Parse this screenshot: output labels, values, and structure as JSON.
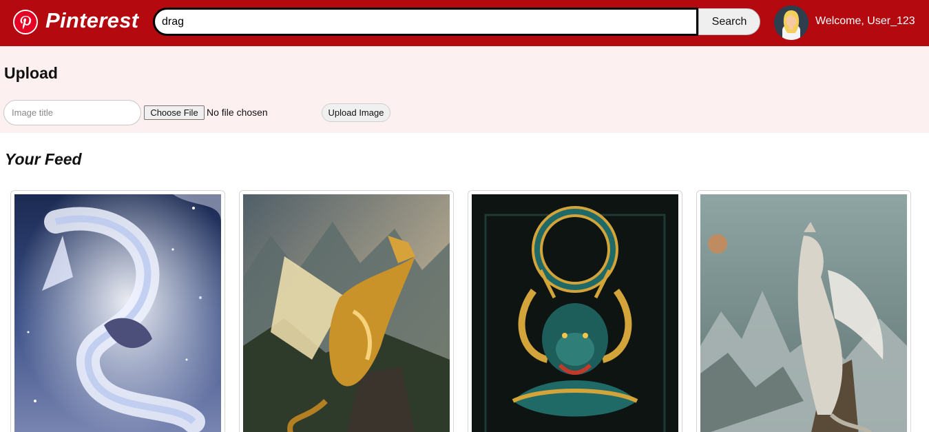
{
  "header": {
    "logo_text": "Pinterest",
    "search_value": "drag",
    "search_button": "Search",
    "welcome": "Welcome, User_123",
    "brand_color": "#b3090f"
  },
  "upload": {
    "title": "Upload",
    "title_placeholder": "Image title",
    "choose_file": "Choose File",
    "no_file": "No file chosen",
    "upload_button": "Upload Image"
  },
  "feed": {
    "title": "Your Feed",
    "pins": [
      {
        "icon": "silver-dragon-image"
      },
      {
        "icon": "golden-dragon-image"
      },
      {
        "icon": "teal-eastern-dragon-image"
      },
      {
        "icon": "pale-mountain-dragon-image"
      }
    ]
  }
}
